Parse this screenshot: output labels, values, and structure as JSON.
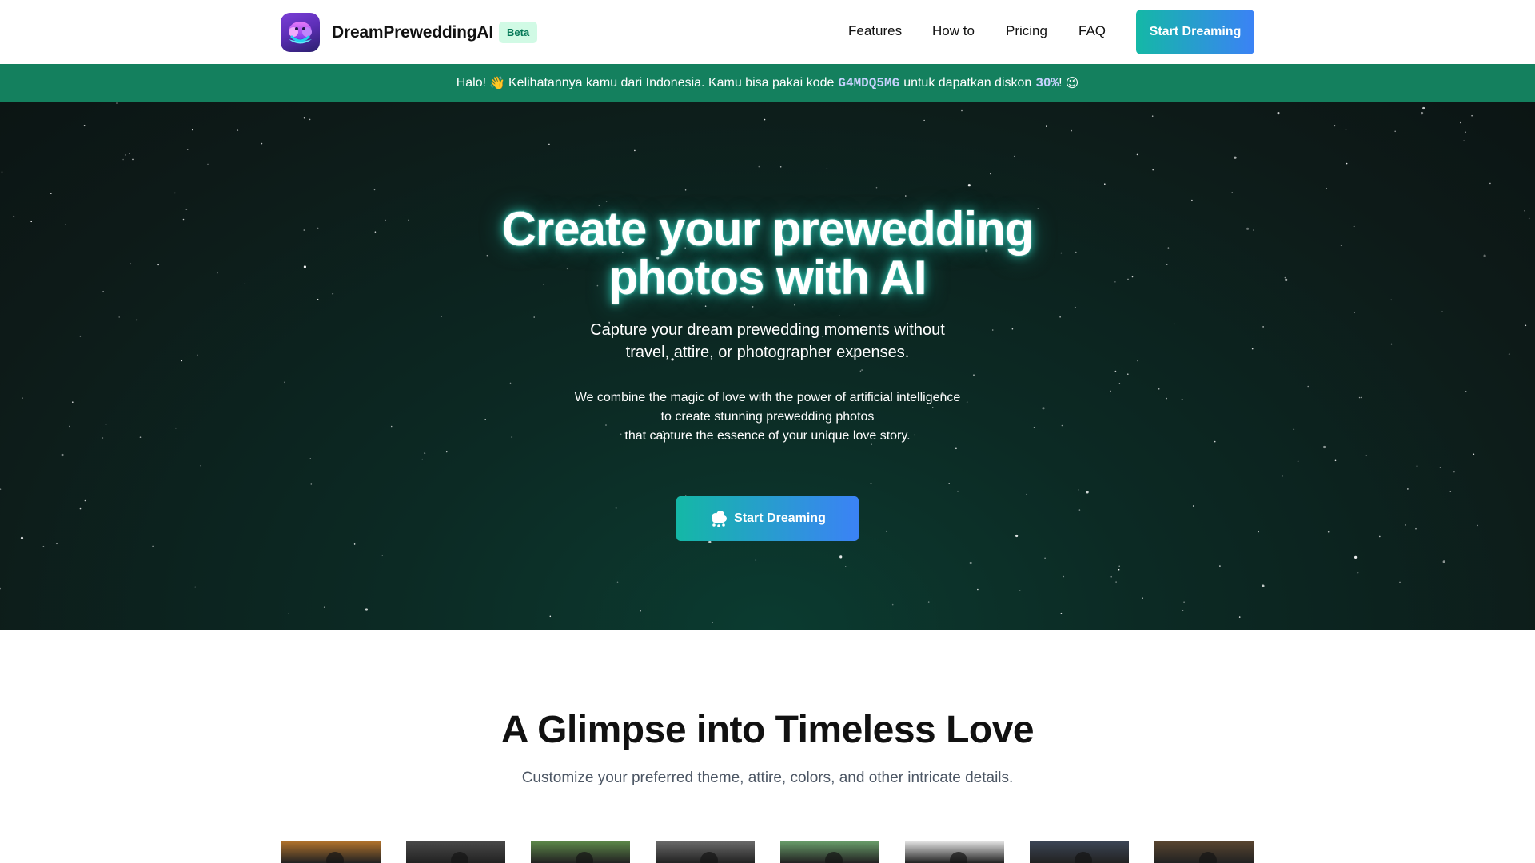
{
  "brand": {
    "name": "DreamPreweddingAI",
    "badge": "Beta",
    "logo_icon": "cloud-smile-icon"
  },
  "nav": {
    "items": [
      {
        "label": "Features"
      },
      {
        "label": "How to"
      },
      {
        "label": "Pricing"
      },
      {
        "label": "FAQ"
      }
    ],
    "cta_label": "Start Dreaming"
  },
  "banner": {
    "greeting": "Halo!",
    "wave_emoji": "👋",
    "text_before_code": "Kelihatannya kamu dari Indonesia. Kamu bisa pakai kode",
    "code": "G4MDQ5MG",
    "text_after_code": "untuk dapatkan diskon",
    "discount": "30%",
    "end": "!",
    "wink_emoji": "😉",
    "bg_color": "#14805e"
  },
  "hero": {
    "title_line1": "Create your prewedding",
    "title_line2": "photos with AI",
    "subtitle_line1": "Capture your dream prewedding moments without",
    "subtitle_line2": "travel, attire, or photographer expenses.",
    "desc_line1": "We combine the magic of love with the power of artificial intelligence",
    "desc_line2": "to create stunning prewedding photos",
    "desc_line3": "that capture the essence of your unique love story.",
    "cta_label": "Start Dreaming",
    "cta_icon": "brain-cloud-icon",
    "accent_gradient": [
      "#14b8a6",
      "#3b82f6"
    ]
  },
  "gallery": {
    "title": "A Glimpse into Timeless Love",
    "subtitle": "Customize your preferred theme, attire, colors, and other intricate details.",
    "thumbnails": [
      {
        "name": "gallery-photo-1",
        "tone": "#b5742c"
      },
      {
        "name": "gallery-photo-2",
        "tone": "#4a4a4a"
      },
      {
        "name": "gallery-photo-3",
        "tone": "#5e8a4a"
      },
      {
        "name": "gallery-photo-4",
        "tone": "#6b6b6b"
      },
      {
        "name": "gallery-photo-5",
        "tone": "#6aa06b"
      },
      {
        "name": "gallery-photo-6",
        "tone": "#e8e8e8"
      },
      {
        "name": "gallery-photo-7",
        "tone": "#3c4656"
      },
      {
        "name": "gallery-photo-8",
        "tone": "#5a4630"
      }
    ]
  }
}
